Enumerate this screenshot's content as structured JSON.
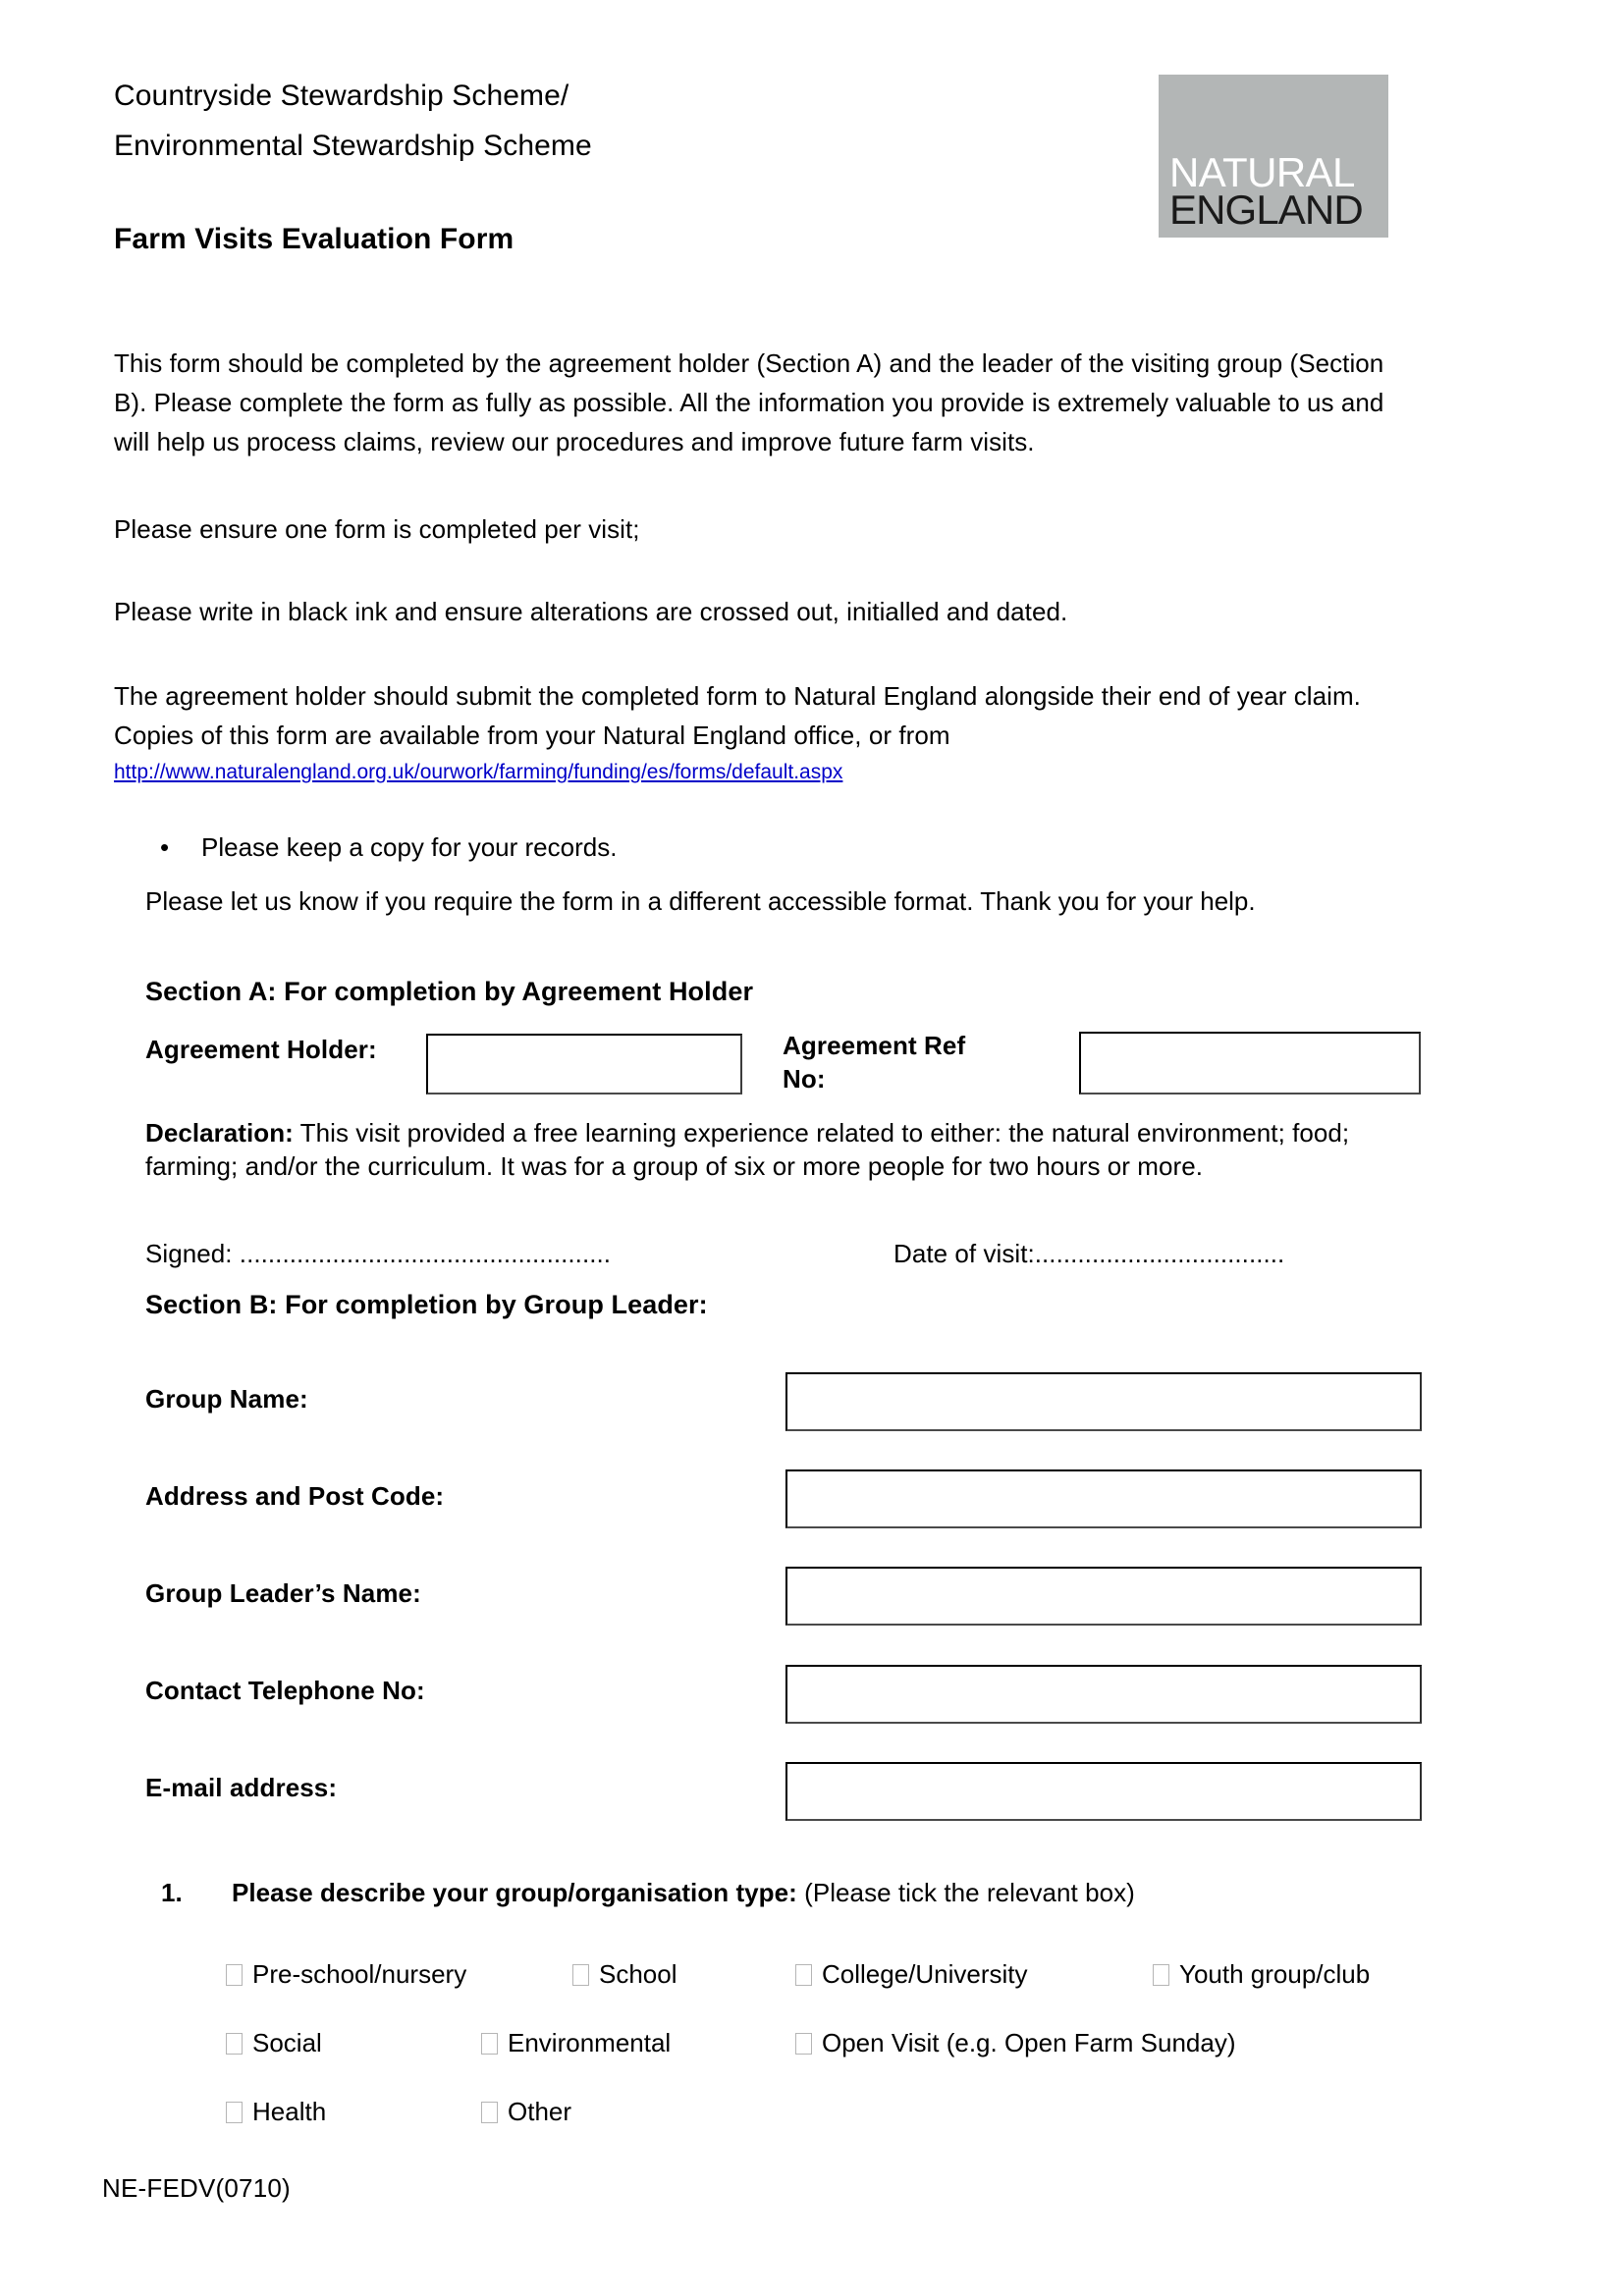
{
  "header": {
    "scheme_line_1": "Countryside Stewardship Scheme/",
    "scheme_line_2": "Environmental Stewardship Scheme",
    "form_title": "Farm Visits Evaluation Form",
    "logo": {
      "line_1": "NATURAL",
      "line_2": "ENGLAND",
      "background_color": "#b3b6b6",
      "line_1_color": "#ffffff",
      "line_2_color": "#1a1a1a"
    }
  },
  "intro": {
    "paragraph_1": "This form should be completed by the agreement holder (Section A) and the leader of the visiting group (Section B). Please complete the form as fully as possible.  All the information you provide is extremely valuable to us and will help us process claims, review our procedures and improve future farm visits.",
    "paragraph_2": "Please ensure one form is completed per visit;",
    "paragraph_3": "Please write in black ink and ensure alterations are crossed out, initialled and dated.",
    "paragraph_4": "The agreement holder should submit the completed form to Natural England alongside their end of year claim. Copies of this form are available from your Natural England office, or from",
    "link_text": "http://www.naturalengland.org.uk/ourwork/farming/funding/es/forms/default.aspx",
    "link_color": "#0000c8",
    "bullet_marker": "•",
    "bullet_text": "Please keep a copy for your records.",
    "paragraph_5": "Please let us know if you require the form in a different accessible format. Thank you for your help."
  },
  "section_a": {
    "heading": "Section A: For completion by Agreement Holder",
    "agreement_holder_label": "Agreement Holder:",
    "agreement_holder_value": "",
    "agreement_ref_label": "Agreement Ref No:",
    "agreement_ref_value": "",
    "declaration_label": "Declaration:",
    "declaration_text": " This visit provided a free learning experience related to either: the natural environment; food; farming; and/or the curriculum. It was for a group of six or more people for two hours or more.",
    "signed_line": "Signed: ....................................................",
    "date_line": "Date of visit:..................................."
  },
  "section_b": {
    "heading": "Section B: For completion by Group Leader:",
    "fields": [
      {
        "label": "Group Name:",
        "value": ""
      },
      {
        "label": "Address and Post Code:",
        "value": ""
      },
      {
        "label": "Group Leader’s Name:",
        "value": ""
      },
      {
        "label": "Contact Telephone No:",
        "value": ""
      },
      {
        "label": "E-mail address:",
        "value": ""
      }
    ]
  },
  "question_1": {
    "number": "1.",
    "text": "Please describe your group/organisation type:",
    "hint": " (Please tick the relevant box)",
    "options_row_1": [
      {
        "label": "Pre-school/nursery",
        "checked": false
      },
      {
        "label": "School",
        "checked": false
      },
      {
        "label": "College/University",
        "checked": false
      },
      {
        "label": "Youth group/club",
        "checked": false
      }
    ],
    "options_row_2": [
      {
        "label": "Social",
        "checked": false
      },
      {
        "label": "Environmental",
        "checked": false
      },
      {
        "label": "Open Visit (e.g. Open Farm Sunday)",
        "checked": false
      }
    ],
    "options_row_3": [
      {
        "label": "Health",
        "checked": false
      },
      {
        "label": "Other",
        "checked": false
      }
    ]
  },
  "footer": {
    "document_code": "NE-FEDV(0710)"
  }
}
